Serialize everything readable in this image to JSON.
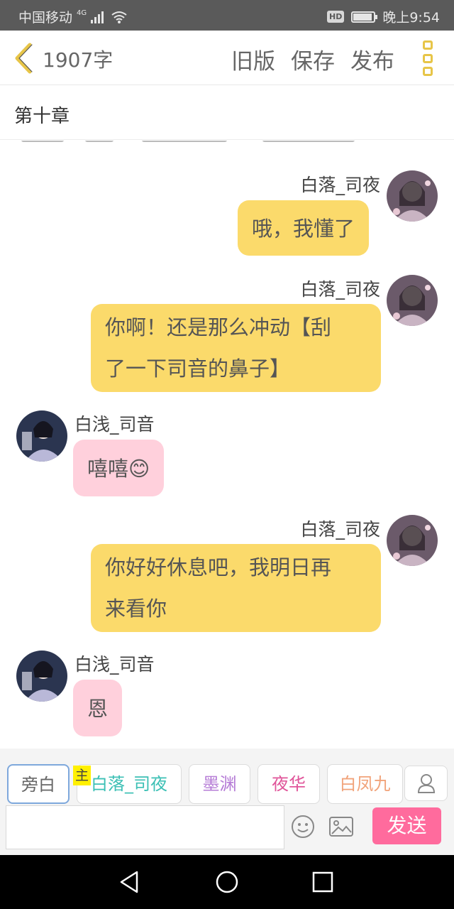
{
  "status_bar": {
    "carrier": "中国移动",
    "network": "4G",
    "hd": "HD",
    "battery_level": 0.9,
    "time": "晚上9:54"
  },
  "top_bar": {
    "word_count": "1907字",
    "old_version": "旧版",
    "save": "保存",
    "publish": "发布"
  },
  "chapter": {
    "title": "第十章"
  },
  "messages": [
    {
      "side": "right",
      "name": "白落_司夜",
      "lines": [
        "哦，我懂了"
      ]
    },
    {
      "side": "right",
      "name": "白落_司夜",
      "lines": [
        "你啊！还是那么冲动【刮",
        "了一下司音的鼻子】"
      ]
    },
    {
      "side": "left",
      "name": "白浅_司音",
      "lines": [
        "嘻嘻😊"
      ]
    },
    {
      "side": "right",
      "name": "白落_司夜",
      "lines": [
        "你好好休息吧，我明日再",
        "来看你"
      ]
    },
    {
      "side": "left",
      "name": "白浅_司音",
      "lines": [
        "恩"
      ]
    }
  ],
  "roles": [
    {
      "label": "旁白",
      "color": "#666666",
      "active": true
    },
    {
      "label": "白落_司夜",
      "color": "#3cc0b5",
      "active": false
    },
    {
      "label": "墨渊",
      "color": "#b57bd6",
      "active": false
    },
    {
      "label": "夜华",
      "color": "#e0559a",
      "active": false
    },
    {
      "label": "白凤九",
      "color": "#f1a37a",
      "active": false
    }
  ],
  "host_tag": "主",
  "input": {
    "value": "",
    "placeholder": ""
  },
  "send_label": "发送",
  "colors": {
    "accent": "#e7c548",
    "right_bubble": "#fbda6b",
    "left_bubble": "#ffd0dc",
    "send_button": "#ff6b9d"
  },
  "icons": {
    "back": "chevron-left-icon",
    "menu": "more-vertical-icon",
    "emoji": "emoji-icon",
    "image": "image-icon",
    "person": "person-icon",
    "signal": "signal-icon",
    "wifi": "wifi-icon"
  }
}
